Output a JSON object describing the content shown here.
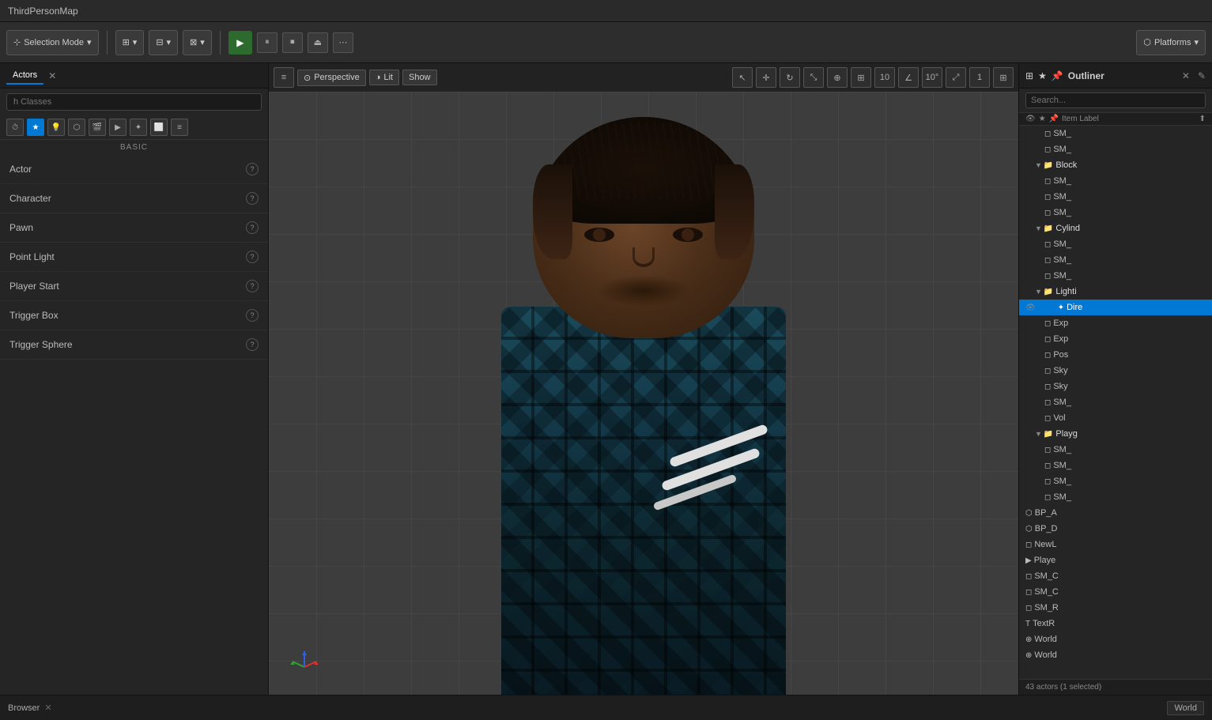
{
  "titleBar": {
    "title": "ThirdPersonMap"
  },
  "toolbar": {
    "selectionMode": "Selection Mode",
    "playButton": "▶",
    "pauseButton": "⏸",
    "stopButton": "⏹",
    "ejectButton": "⏏",
    "moreButton": "⋯",
    "platforms": "Platforms"
  },
  "leftPanel": {
    "tabLabel": "Actors",
    "searchPlaceholder": "h Classes",
    "categoryLabel": "BASIC",
    "items": [
      {
        "label": "Actor",
        "id": "actor"
      },
      {
        "label": "Character",
        "id": "character"
      },
      {
        "label": "Pawn",
        "id": "pawn"
      },
      {
        "label": "Point Light",
        "id": "point-light"
      },
      {
        "label": "Player Start",
        "id": "player-start"
      },
      {
        "label": "Trigger Box",
        "id": "trigger-box"
      },
      {
        "label": "Trigger Sphere",
        "id": "trigger-sphere"
      }
    ]
  },
  "viewport": {
    "perspectiveLabel": "Perspective",
    "litLabel": "Lit",
    "showLabel": "Show",
    "gridValue": "10",
    "angleValue": "10°",
    "scaleValue": "1"
  },
  "outliner": {
    "title": "Outliner",
    "searchPlaceholder": "Search...",
    "columnLabel": "Item Label",
    "treeItems": [
      {
        "label": "SM_",
        "indent": 2,
        "type": "mesh",
        "id": "sm1"
      },
      {
        "label": "SM_",
        "indent": 2,
        "type": "mesh",
        "id": "sm2"
      },
      {
        "label": "Block",
        "indent": 1,
        "type": "folder",
        "id": "block-folder"
      },
      {
        "label": "SM_",
        "indent": 2,
        "type": "mesh",
        "id": "sm3"
      },
      {
        "label": "SM_",
        "indent": 2,
        "type": "mesh",
        "id": "sm4"
      },
      {
        "label": "SM_",
        "indent": 2,
        "type": "mesh",
        "id": "sm5"
      },
      {
        "label": "Cylind",
        "indent": 1,
        "type": "folder",
        "id": "cylind-folder"
      },
      {
        "label": "SM_",
        "indent": 2,
        "type": "mesh",
        "id": "sm6"
      },
      {
        "label": "SM_",
        "indent": 2,
        "type": "mesh",
        "id": "sm7"
      },
      {
        "label": "SM_",
        "indent": 2,
        "type": "mesh",
        "id": "sm8"
      },
      {
        "label": "Lighti",
        "indent": 1,
        "type": "folder",
        "id": "lighting-folder"
      },
      {
        "label": "Dire",
        "indent": 2,
        "type": "light",
        "id": "directional-light",
        "selected": true
      },
      {
        "label": "Exp",
        "indent": 2,
        "type": "mesh",
        "id": "exp1"
      },
      {
        "label": "Exp",
        "indent": 2,
        "type": "mesh",
        "id": "exp2"
      },
      {
        "label": "Pos",
        "indent": 2,
        "type": "mesh",
        "id": "pos1"
      },
      {
        "label": "Sky",
        "indent": 2,
        "type": "mesh",
        "id": "sky1"
      },
      {
        "label": "Sky",
        "indent": 2,
        "type": "mesh",
        "id": "sky2"
      },
      {
        "label": "SM_",
        "indent": 2,
        "type": "mesh",
        "id": "sm9"
      },
      {
        "label": "Vol",
        "indent": 2,
        "type": "mesh",
        "id": "vol1"
      },
      {
        "label": "Playg",
        "indent": 1,
        "type": "folder",
        "id": "playg-folder"
      },
      {
        "label": "SM_",
        "indent": 2,
        "type": "mesh",
        "id": "sm10"
      },
      {
        "label": "SM_",
        "indent": 2,
        "type": "mesh",
        "id": "sm11"
      },
      {
        "label": "SM_",
        "indent": 2,
        "type": "mesh",
        "id": "sm12"
      },
      {
        "label": "SM_",
        "indent": 2,
        "type": "mesh",
        "id": "sm13"
      },
      {
        "label": "BP_A",
        "indent": 0,
        "type": "blueprint",
        "id": "bp-a"
      },
      {
        "label": "BP_D",
        "indent": 0,
        "type": "blueprint",
        "id": "bp-d"
      },
      {
        "label": "NewL",
        "indent": 0,
        "type": "mesh",
        "id": "newl"
      },
      {
        "label": "Playe",
        "indent": 0,
        "type": "player",
        "id": "player"
      },
      {
        "label": "SM_C",
        "indent": 0,
        "type": "mesh",
        "id": "smc"
      },
      {
        "label": "SM_C",
        "indent": 0,
        "type": "mesh",
        "id": "smc2"
      },
      {
        "label": "SM_R",
        "indent": 0,
        "type": "mesh",
        "id": "smr"
      },
      {
        "label": "TextR",
        "indent": 0,
        "type": "text",
        "id": "textr"
      },
      {
        "label": "World",
        "indent": 0,
        "type": "world",
        "id": "world1"
      },
      {
        "label": "World",
        "indent": 0,
        "type": "world",
        "id": "world2"
      }
    ],
    "statusText": "43 actors (1 selected)"
  },
  "bottomBar": {
    "browserLabel": "Browser",
    "worldLabel": "World"
  },
  "colors": {
    "accent": "#0078d4",
    "playGreen": "#2d6a2d",
    "folderOrange": "#e8a020",
    "selectedBlue": "#0078d4"
  }
}
